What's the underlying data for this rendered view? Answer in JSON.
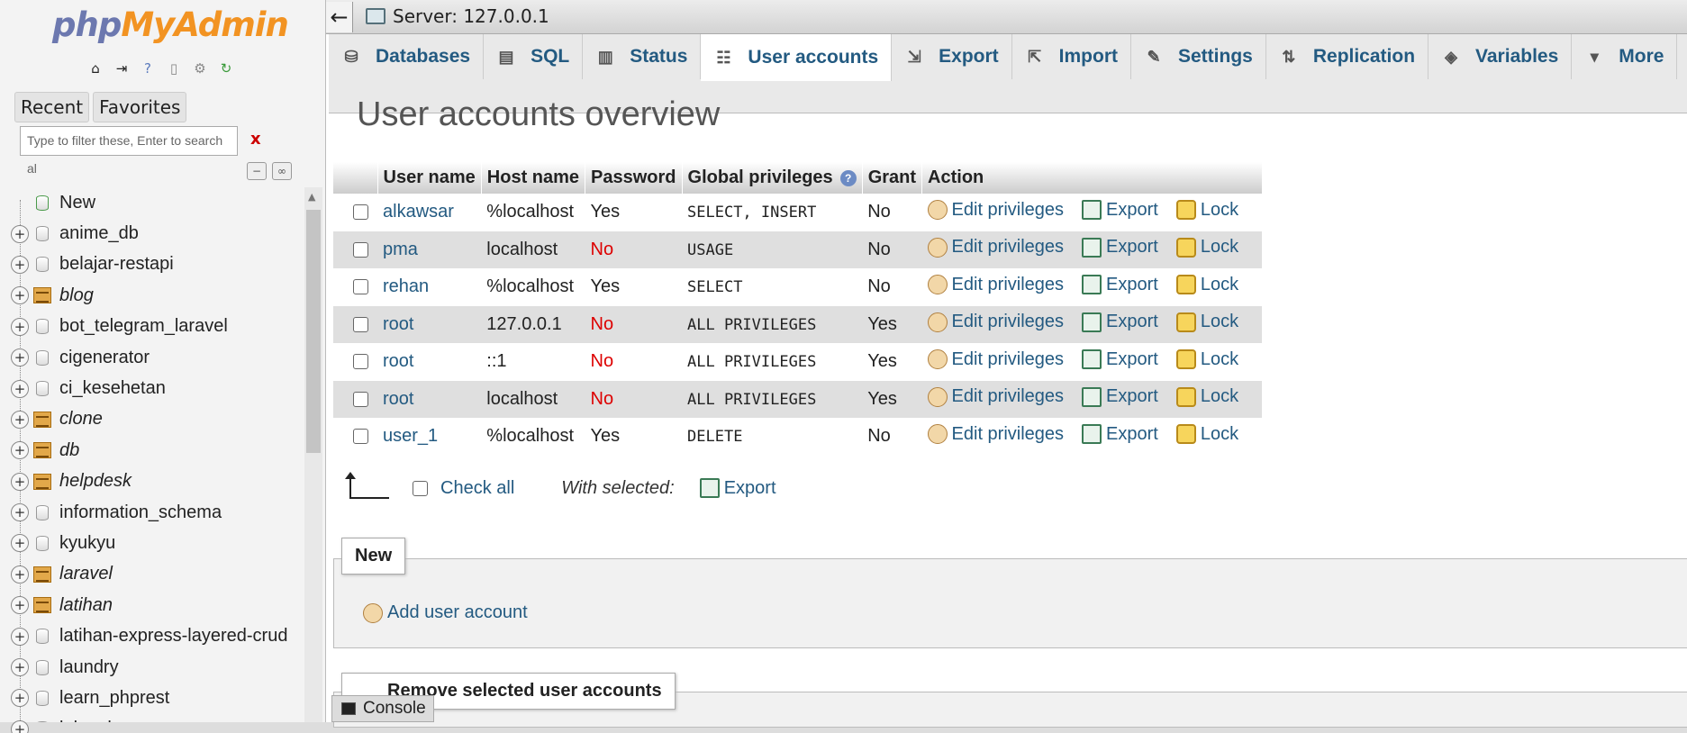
{
  "logo": {
    "php": "php",
    "myadmin": "MyAdmin"
  },
  "nav": {
    "tabs": [
      "Recent",
      "Favorites"
    ],
    "filter_placeholder": "Type to filter these, Enter to search al",
    "filter_clear": "x",
    "databases": [
      {
        "name": "New",
        "kind": "new"
      },
      {
        "name": "anime_db",
        "kind": "db"
      },
      {
        "name": "belajar-restapi",
        "kind": "db"
      },
      {
        "name": "blog",
        "kind": "box"
      },
      {
        "name": "bot_telegram_laravel",
        "kind": "db"
      },
      {
        "name": "cigenerator",
        "kind": "db"
      },
      {
        "name": "ci_kesehetan",
        "kind": "db"
      },
      {
        "name": "clone",
        "kind": "box"
      },
      {
        "name": "db",
        "kind": "box"
      },
      {
        "name": "helpdesk",
        "kind": "box"
      },
      {
        "name": "information_schema",
        "kind": "db"
      },
      {
        "name": "kyukyu",
        "kind": "db"
      },
      {
        "name": "laravel",
        "kind": "box"
      },
      {
        "name": "latihan",
        "kind": "box"
      },
      {
        "name": "latihan-express-layered-crud",
        "kind": "db"
      },
      {
        "name": "laundry",
        "kind": "db"
      },
      {
        "name": "learn_phprest",
        "kind": "db"
      },
      {
        "name": "lelangku",
        "kind": "db"
      }
    ]
  },
  "topbar": {
    "back": "←",
    "server": "Server: 127.0.0.1"
  },
  "tabs": [
    {
      "label": "Databases",
      "icon": "database-icon",
      "active": false
    },
    {
      "label": "SQL",
      "icon": "sql-icon",
      "active": false
    },
    {
      "label": "Status",
      "icon": "status-icon",
      "active": false
    },
    {
      "label": "User accounts",
      "icon": "user-accounts-icon",
      "active": true
    },
    {
      "label": "Export",
      "icon": "export-icon",
      "active": false
    },
    {
      "label": "Import",
      "icon": "import-icon",
      "active": false
    },
    {
      "label": "Settings",
      "icon": "wrench-icon",
      "active": false
    },
    {
      "label": "Replication",
      "icon": "replication-icon",
      "active": false
    },
    {
      "label": "Variables",
      "icon": "variables-icon",
      "active": false
    },
    {
      "label": "More",
      "icon": "chevron-down-icon",
      "active": false
    }
  ],
  "page_title": "User accounts overview",
  "table": {
    "headers": [
      "User name",
      "Host name",
      "Password",
      "Global privileges",
      "Grant",
      "Action"
    ],
    "rows": [
      {
        "user": "alkawsar",
        "host": "%localhost",
        "password": "Yes",
        "privileges": "SELECT, INSERT",
        "grant": "No"
      },
      {
        "user": "pma",
        "host": "localhost",
        "password": "No",
        "privileges": "USAGE",
        "grant": "No"
      },
      {
        "user": "rehan",
        "host": "%localhost",
        "password": "Yes",
        "privileges": "SELECT",
        "grant": "No"
      },
      {
        "user": "root",
        "host": "127.0.0.1",
        "password": "No",
        "privileges": "ALL PRIVILEGES",
        "grant": "Yes"
      },
      {
        "user": "root",
        "host": "::1",
        "password": "No",
        "privileges": "ALL PRIVILEGES",
        "grant": "Yes"
      },
      {
        "user": "root",
        "host": "localhost",
        "password": "No",
        "privileges": "ALL PRIVILEGES",
        "grant": "Yes"
      },
      {
        "user": "user_1",
        "host": "%localhost",
        "password": "Yes",
        "privileges": "DELETE",
        "grant": "No"
      }
    ],
    "actions": [
      "Edit privileges",
      "Export",
      "Lock"
    ]
  },
  "bulk": {
    "check_all": "Check all",
    "with_selected": "With selected:",
    "export": "Export"
  },
  "new_section": {
    "legend": "New",
    "add_user": "Add user account"
  },
  "remove_section": {
    "legend": "Remove selected user accounts"
  },
  "console": "Console",
  "colors": {
    "link": "#235a81",
    "no": "#d00000",
    "logo_php": "#6c78af",
    "logo_myadmin": "#f29322"
  }
}
